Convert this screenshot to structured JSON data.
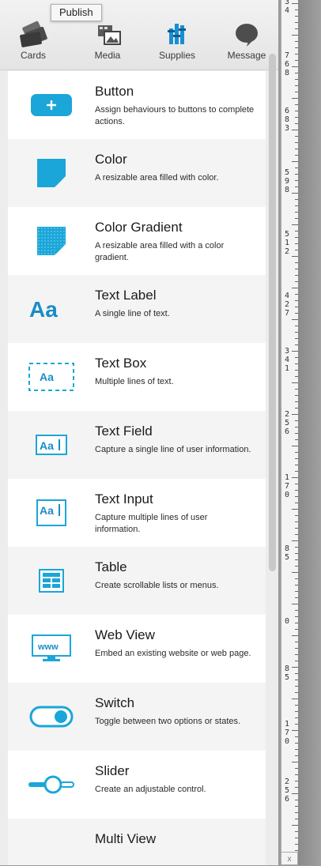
{
  "tooltip": "Publish",
  "toolbar": [
    {
      "label": "Cards",
      "icon": "cards-icon"
    },
    {
      "label": "Media",
      "icon": "media-icon"
    },
    {
      "label": "Supplies",
      "icon": "supplies-icon"
    },
    {
      "label": "Message",
      "icon": "message-icon"
    }
  ],
  "accent": "#1aa6d8",
  "items": [
    {
      "title": "Button",
      "desc": "Assign behaviours to buttons to complete actions.",
      "icon": "button-icon"
    },
    {
      "title": "Color",
      "desc": "A resizable area filled with color.",
      "icon": "color-icon"
    },
    {
      "title": "Color Gradient",
      "desc": "A resizable area filled with a color gradient.",
      "icon": "color-gradient-icon"
    },
    {
      "title": "Text Label",
      "desc": "A single line of text.",
      "icon": "text-label-icon"
    },
    {
      "title": "Text Box",
      "desc": "Multiple lines of text.",
      "icon": "text-box-icon"
    },
    {
      "title": "Text Field",
      "desc": "Capture a single line of user information.",
      "icon": "text-field-icon"
    },
    {
      "title": "Text Input",
      "desc": "Capture multiple lines of user information.",
      "icon": "text-input-icon"
    },
    {
      "title": "Table",
      "desc": "Create scrollable lists or menus.",
      "icon": "table-icon"
    },
    {
      "title": "Web View",
      "desc": "Embed an existing website or web page.",
      "icon": "web-view-icon"
    },
    {
      "title": "Switch",
      "desc": "Toggle between two options or states.",
      "icon": "switch-icon"
    },
    {
      "title": "Slider",
      "desc": "Create an adjustable control.",
      "icon": "slider-icon"
    },
    {
      "title": "Multi View",
      "desc": "",
      "icon": "multi-view-icon"
    }
  ],
  "ruler": {
    "numbers": [
      "3",
      "4",
      "7",
      "6",
      "8",
      "6",
      "8",
      "3",
      "5",
      "9",
      "8",
      "5",
      "1",
      "2",
      "4",
      "2",
      "7",
      "3",
      "4",
      "1",
      "2",
      "5",
      "6",
      "1",
      "7",
      "0",
      "8",
      "5",
      "0",
      "8",
      "5",
      "1",
      "7",
      "0",
      "2",
      "5",
      "6"
    ],
    "corner": "x"
  }
}
